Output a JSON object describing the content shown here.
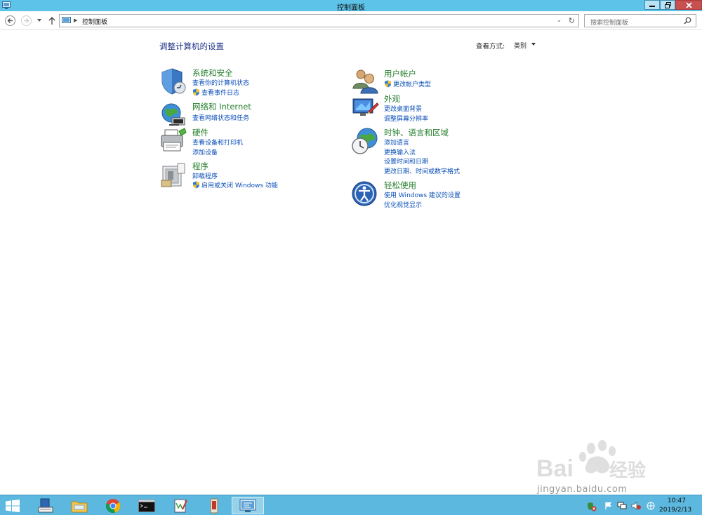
{
  "window": {
    "title": "控制面板"
  },
  "address_bar": {
    "path": "控制面板"
  },
  "search": {
    "placeholder": "搜索控制面板"
  },
  "page": {
    "heading": "调整计算机的设置",
    "view_by_label": "查看方式:",
    "view_by_value": "类别"
  },
  "categories": [
    {
      "title": "系统和安全",
      "icon": "shield-icon",
      "links": [
        {
          "text": "查看你的计算机状态",
          "shield": false
        },
        {
          "text": "查看事件日志",
          "shield": true
        }
      ]
    },
    {
      "title": "网络和 Internet",
      "icon": "network-globe-icon",
      "links": [
        {
          "text": "查看网络状态和任务",
          "shield": false
        }
      ]
    },
    {
      "title": "硬件",
      "icon": "printer-icon",
      "links": [
        {
          "text": "查看设备和打印机",
          "shield": false
        },
        {
          "text": "添加设备",
          "shield": false
        }
      ]
    },
    {
      "title": "程序",
      "icon": "programs-icon",
      "links": [
        {
          "text": "卸载程序",
          "shield": false
        },
        {
          "text": "启用或关闭 Windows 功能",
          "shield": true
        }
      ]
    },
    {
      "title": "用户帐户",
      "icon": "users-icon",
      "links": [
        {
          "text": "更改帐户类型",
          "shield": true
        }
      ]
    },
    {
      "title": "外观",
      "icon": "appearance-icon",
      "links": [
        {
          "text": "更改桌面背景",
          "shield": false
        },
        {
          "text": "调整屏幕分辨率",
          "shield": false
        }
      ]
    },
    {
      "title": "时钟、语言和区域",
      "icon": "clock-globe-icon",
      "links": [
        {
          "text": "添加语言",
          "shield": false
        },
        {
          "text": "更换输入法",
          "shield": false
        },
        {
          "text": "设置时间和日期",
          "shield": false
        },
        {
          "text": "更改日期、时间或数字格式",
          "shield": false
        }
      ]
    },
    {
      "title": "轻松使用",
      "icon": "ease-of-access-icon",
      "links": [
        {
          "text": "使用 Windows 建议的设置",
          "shield": false
        },
        {
          "text": "优化视觉显示",
          "shield": false
        }
      ]
    }
  ],
  "taskbar": {
    "items": [
      "server-manager-icon",
      "file-explorer-icon",
      "chrome-icon",
      "cmd-icon",
      "notepad-icon",
      "app-icon",
      "control-panel-icon"
    ],
    "time": "10:47",
    "date": "2019/2/13"
  },
  "colors": {
    "title_bar": "#5ec3e8",
    "link": "#0b4fb8",
    "category_title": "#267f2c",
    "heading": "#1e3287",
    "taskbar": "#5cb8de"
  }
}
